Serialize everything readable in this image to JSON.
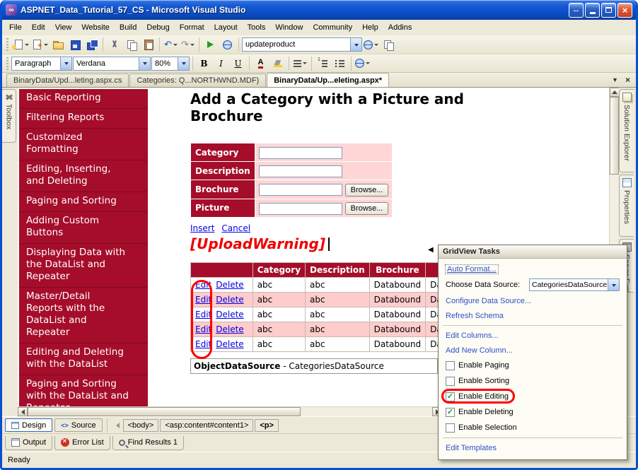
{
  "titlebar": {
    "title": "ASPNET_Data_Tutorial_57_CS - Microsoft Visual Studio"
  },
  "icons": {
    "arrows": "↔",
    "close": "×",
    "dropdown": "▼",
    "tab_close": "×",
    "undo": "↶",
    "redo": "↷",
    "smart_tag": "◀",
    "check": "✓",
    "source_glyph": "<>"
  },
  "menubar": {
    "items": [
      "File",
      "Edit",
      "View",
      "Website",
      "Build",
      "Debug",
      "Format",
      "Layout",
      "Tools",
      "Window",
      "Community",
      "Help",
      "Addins"
    ]
  },
  "toolbars": {
    "standard": {
      "combo_value": "updateproduct"
    },
    "formatting": {
      "style": "Paragraph",
      "font": "Verdana",
      "zoom": "80%",
      "bold": "B",
      "italic": "I",
      "underline": "U",
      "font_color_glyph": "A"
    }
  },
  "document_tabs": {
    "tabs": [
      {
        "label": "BinaryData/Upd...leting.aspx.cs",
        "active": false
      },
      {
        "label": "Categories: Q...NORTHWND.MDF)",
        "active": false
      },
      {
        "label": "BinaryData/Up...eleting.aspx*",
        "active": true
      }
    ]
  },
  "left_panel": {
    "toolbox_label": "Toolbox"
  },
  "right_panel": {
    "tabs": [
      {
        "label": "Solution Explorer",
        "icon": "solution-explorer-icon"
      },
      {
        "label": "Properties",
        "icon": "properties-icon"
      },
      {
        "label": "Server Explorer",
        "icon": "server-explorer-icon"
      }
    ]
  },
  "sidebar": {
    "items": [
      "Basic Reporting",
      "Filtering Reports",
      "Customized Formatting",
      "Editing, Inserting, and Deleting",
      "Paging and Sorting",
      "Adding Custom Buttons",
      "Displaying Data with the DataList and Repeater",
      "Master/Detail Reports with the DataList and Repeater",
      "Editing and Deleting with the DataList",
      "Paging and Sorting with the DataList and Repeater"
    ]
  },
  "page": {
    "heading": "Add a Category with a Picture and Brochure",
    "form": {
      "rows": [
        {
          "label": "Category",
          "browse": null
        },
        {
          "label": "Description",
          "browse": null
        },
        {
          "label": "Brochure",
          "browse": "Browse..."
        },
        {
          "label": "Picture",
          "browse": "Browse..."
        }
      ]
    },
    "links": {
      "insert": "Insert",
      "cancel": "Cancel"
    },
    "warning": "[UploadWarning]",
    "grid": {
      "headers": [
        "",
        "Category",
        "Description",
        "Brochure",
        ""
      ],
      "rows": [
        {
          "edit": "Edit",
          "delete": "Delete",
          "category": "abc",
          "description": "abc",
          "brochure": "Databound",
          "picture": "Databound"
        },
        {
          "edit": "Edit",
          "delete": "Delete",
          "category": "abc",
          "description": "abc",
          "brochure": "Databound",
          "picture": "Databound"
        },
        {
          "edit": "Edit",
          "delete": "Delete",
          "category": "abc",
          "description": "abc",
          "brochure": "Databound",
          "picture": "Databound"
        },
        {
          "edit": "Edit",
          "delete": "Delete",
          "category": "abc",
          "description": "abc",
          "brochure": "Databound",
          "picture": "Databound"
        },
        {
          "edit": "Edit",
          "delete": "Delete",
          "category": "abc",
          "description": "abc",
          "brochure": "Databound",
          "picture": "Databound"
        }
      ]
    },
    "datasource": {
      "name": "ObjectDataSource",
      "rest": " - CategoriesDataSource"
    }
  },
  "popup": {
    "title": "GridView Tasks",
    "auto_format": "Auto Format...",
    "choose_label": "Choose Data Source:",
    "choose_value": "CategoriesDataSource",
    "links_top": [
      "Configure Data Source...",
      "Refresh Schema"
    ],
    "links_mid": [
      "Edit Columns...",
      "Add New Column..."
    ],
    "checkboxes": [
      {
        "label": "Enable Paging",
        "checked": false
      },
      {
        "label": "Enable Sorting",
        "checked": false
      },
      {
        "label": "Enable Editing",
        "checked": true,
        "circled": true
      },
      {
        "label": "Enable Deleting",
        "checked": true
      },
      {
        "label": "Enable Selection",
        "checked": false
      }
    ],
    "edit_templates": "Edit Templates"
  },
  "bottom": {
    "design_label": "Design",
    "source_label": "Source",
    "tags": [
      {
        "label": "<body>",
        "bold": false
      },
      {
        "label": "<asp:content#content1>",
        "bold": false
      },
      {
        "label": "<p>",
        "bold": true
      }
    ],
    "panels": [
      {
        "label": "Output",
        "icon": "output-icon"
      },
      {
        "label": "Error List",
        "icon": "error-list-icon"
      },
      {
        "label": "Find Results 1",
        "icon": "find-results-icon"
      }
    ],
    "status": "Ready"
  },
  "colors": {
    "maroon": "#A50D2A",
    "pink": "#FFCCCC",
    "annotation_red": "#FF0000",
    "link_blue": "#0000E6",
    "popup_link_blue": "#3050C8"
  }
}
